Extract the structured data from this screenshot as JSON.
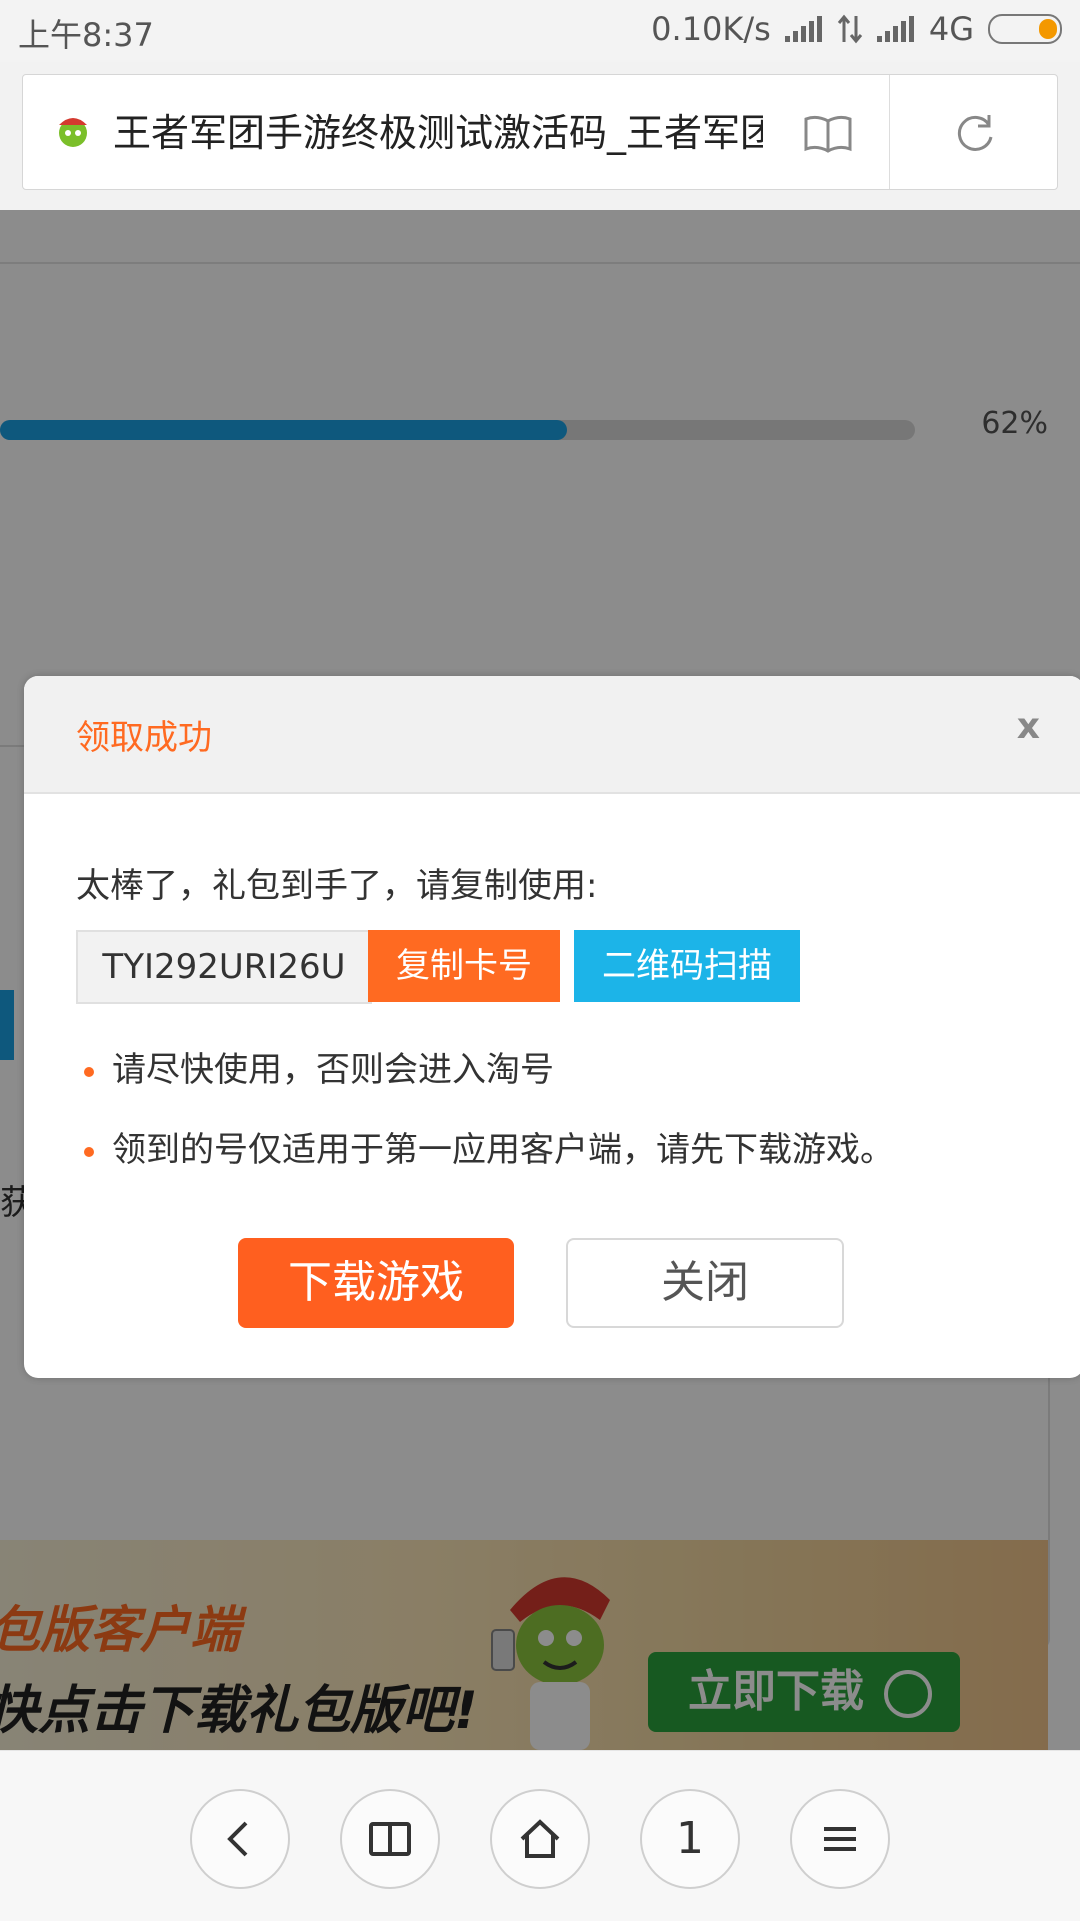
{
  "status_bar": {
    "time": "上午8:37",
    "net_speed": "0.10K/s",
    "network": "4G"
  },
  "address_bar": {
    "title": "王者军团手游终极测试激活码_王者军团手游"
  },
  "page": {
    "progress": {
      "percent_label": "62%",
      "value": 0.62
    },
    "fragment_text": "获"
  },
  "banner": {
    "line1": "包版客户端",
    "line2": "快点击下载礼包版吧!",
    "download_label": "立即下载"
  },
  "modal": {
    "title": "领取成功",
    "close_label": "x",
    "message": "太棒了，礼包到手了，请复制使用:",
    "code": "TYI292URI26U",
    "copy_label": "复制卡号",
    "qr_label": "二维码扫描",
    "notes": [
      "请尽快使用，否则会进入淘号",
      "领到的号仅适用于第一应用客户端，请先下载游戏。"
    ],
    "download_label": "下载游戏",
    "dismiss_label": "关闭"
  },
  "bottom_nav": {
    "tab_count": "1"
  },
  "colors": {
    "accent_orange": "#ff6a21",
    "accent_blue": "#1cb4e8",
    "banner_green": "#2aa33d"
  }
}
